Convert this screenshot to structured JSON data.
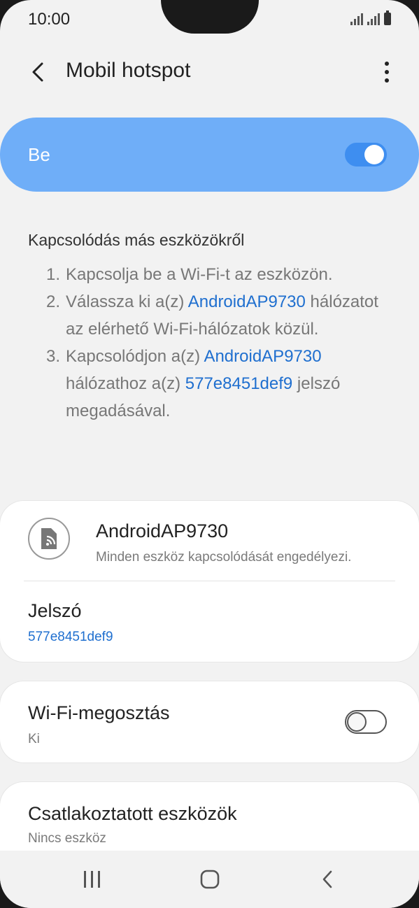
{
  "status_bar": {
    "time": "10:00"
  },
  "app_bar": {
    "title": "Mobil hotspot"
  },
  "master_switch": {
    "label": "Be",
    "state": true,
    "accent": "#6faef8"
  },
  "instructions": {
    "header": "Kapcsolódás más eszközökről",
    "steps": [
      {
        "num": "1.",
        "text": "Kapcsolja be a Wi-Fi-t az eszközön."
      },
      {
        "num": "2.",
        "pre": "Válassza ki a(z) ",
        "ssid": "AndroidAP9730",
        "post": " hálózatot az elérhető Wi-Fi-hálózatok közül."
      },
      {
        "num": "3.",
        "pre": "Kapcsolódjon a(z) ",
        "ssid": "AndroidAP9730",
        "mid": " hálózathoz a(z) ",
        "password": "577e8451def9",
        "post": " jelszó megadásával."
      }
    ]
  },
  "network": {
    "name": "AndroidAP9730",
    "description": "Minden eszköz kapcsolódását engedélyezi.",
    "icon": "hotspot-device-icon",
    "password_label": "Jelszó",
    "password_value": "577e8451def9"
  },
  "wifi_sharing": {
    "label": "Wi-Fi-megosztás",
    "state_text": "Ki",
    "state": false
  },
  "connected_devices": {
    "label": "Csatlakoztatott eszközök",
    "state_text": "Nincs eszköz"
  },
  "nav": {
    "icons": [
      "recents-icon",
      "home-icon",
      "back-icon"
    ]
  },
  "colors": {
    "link": "#1f6fcf",
    "toggle_on": "#3e8ef0",
    "background": "#f2f2f2"
  }
}
